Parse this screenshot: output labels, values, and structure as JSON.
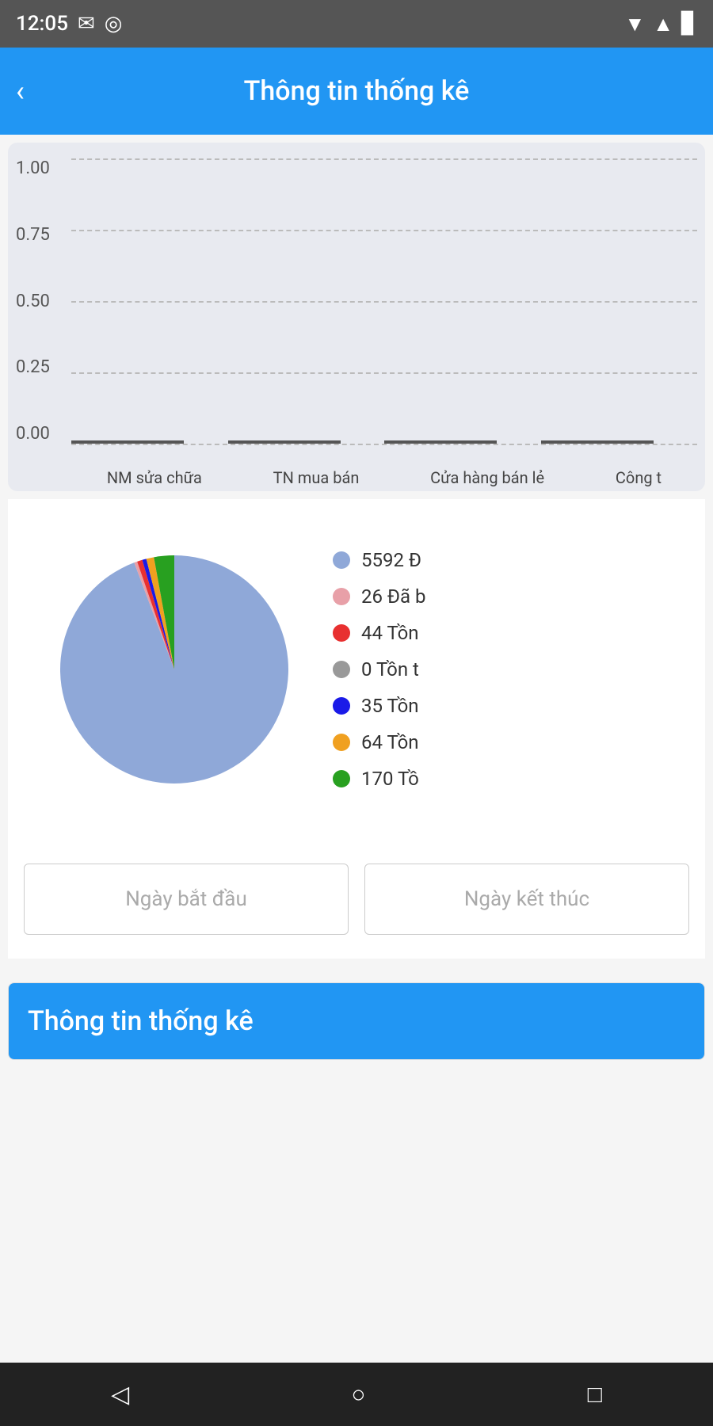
{
  "statusBar": {
    "time": "12:05",
    "icons": [
      "email",
      "record"
    ]
  },
  "appBar": {
    "title": "Thông tin thống kê",
    "backLabel": "‹"
  },
  "lineChart": {
    "yLabels": [
      "1.00",
      "0.75",
      "0.50",
      "0.25",
      "0.00"
    ],
    "xLabels": [
      "NM sửa chữa",
      "TN mua bán",
      "Cửa hàng bán lẻ",
      "Công t"
    ]
  },
  "pieChart": {
    "legend": [
      {
        "color": "#8fa8d8",
        "text": "5592 Đ",
        "id": "slice-blue"
      },
      {
        "color": "#e8a0a8",
        "text": "26 Đã b",
        "id": "slice-pink"
      },
      {
        "color": "#e83030",
        "text": "44 Tồn",
        "id": "slice-red"
      },
      {
        "color": "#888",
        "text": "0 Tồn t",
        "id": "slice-gray"
      },
      {
        "color": "#1a1ae8",
        "text": "35 Tồn",
        "id": "slice-darkblue"
      },
      {
        "color": "#f0a020",
        "text": "64 Tồn",
        "id": "slice-orange"
      },
      {
        "color": "#28a020",
        "text": "170 Tồ",
        "id": "slice-green"
      }
    ]
  },
  "datePickers": {
    "startPlaceholder": "Ngày bắt đầu",
    "endPlaceholder": "Ngày kết thúc"
  },
  "bottomCard": {
    "title": "Thông tin thống kê"
  },
  "navBar": {
    "backSymbol": "◁",
    "homeSymbol": "○",
    "squareSymbol": "□"
  }
}
